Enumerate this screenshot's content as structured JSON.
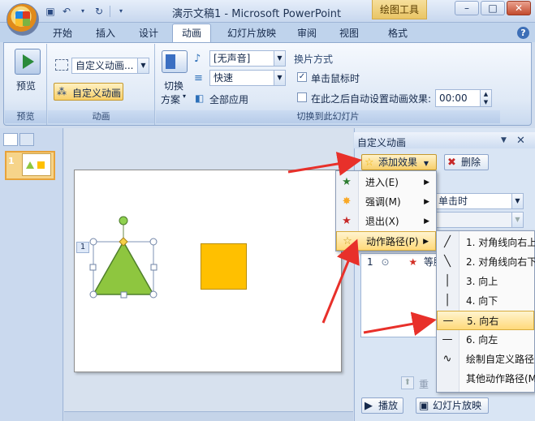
{
  "window": {
    "title": "演示文稿1 - Microsoft PowerPoint",
    "contextual_tab": "绘图工具",
    "minimize": "–",
    "restore": "□",
    "close": "✕"
  },
  "tabs": [
    {
      "label": "开始"
    },
    {
      "label": "插入"
    },
    {
      "label": "设计"
    },
    {
      "label": "动画"
    },
    {
      "label": "幻灯片放映"
    },
    {
      "label": "审阅"
    },
    {
      "label": "视图"
    },
    {
      "label": "格式"
    }
  ],
  "ribbon": {
    "preview_group": {
      "label": "预览",
      "button": "预览"
    },
    "animation_group": {
      "label": "动画",
      "animate_combo": "自定义动画...",
      "custom_anim_button": "自定义动画"
    },
    "transition_group": {
      "label": "切换到此幻灯片",
      "scheme_button_line1": "切换",
      "scheme_button_line2": "方案",
      "sound_combo": "[无声音]",
      "speed_combo": "快速",
      "apply_all": "全部应用",
      "advance_title": "换片方式",
      "on_click": "单击鼠标时",
      "auto_after": "在此之后自动设置动画效果:",
      "time_value": "00:00"
    }
  },
  "slide_panel": {
    "thumb_number": "1"
  },
  "slide": {
    "anim_tag": "1"
  },
  "task_pane": {
    "title": "自定义动画",
    "add_effect": "添加效果",
    "remove": "删除",
    "start_value": "单击时",
    "list_item_num": "1",
    "list_item_text": "等腰",
    "reorder": "重",
    "play": "播放",
    "slideshow": "幻灯片放映"
  },
  "menu_effects": [
    {
      "label": "进入(E)",
      "icon": "entrance-star-icon",
      "color": "#2e7d32"
    },
    {
      "label": "强调(M)",
      "icon": "emphasis-star-icon",
      "color": "#f9a825"
    },
    {
      "label": "退出(X)",
      "icon": "exit-star-icon",
      "color": "#c62828"
    },
    {
      "label": "动作路径(P)",
      "icon": "motion-path-star-icon",
      "color": "#ffffff"
    }
  ],
  "menu_paths": [
    {
      "label": "1. 对角线向右上"
    },
    {
      "label": "2. 对角线向右下"
    },
    {
      "label": "3. 向上"
    },
    {
      "label": "4. 向下"
    },
    {
      "label": "5. 向右"
    },
    {
      "label": "6. 向左"
    },
    {
      "label": "绘制自定义路径(D)"
    },
    {
      "label": "其他动作路径(M)..."
    }
  ],
  "colors": {
    "triangle_fill": "#8ec63f",
    "square_fill": "#ffc000",
    "arrow": "#e8302a",
    "highlight": "#ffd97a"
  }
}
